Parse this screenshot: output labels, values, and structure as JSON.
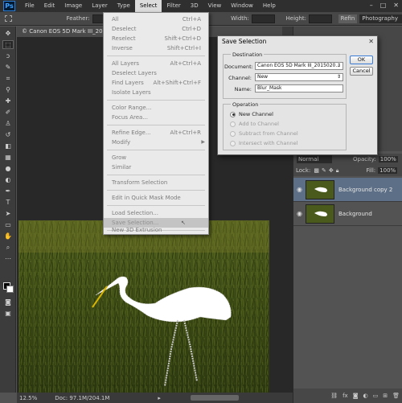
{
  "menubar": {
    "logo": "Ps",
    "items": [
      "File",
      "Edit",
      "Image",
      "Layer",
      "Type",
      "Select",
      "Filter",
      "3D",
      "View",
      "Window",
      "Help"
    ],
    "active": "Select"
  },
  "optbar": {
    "feather_label": "Feather:",
    "width_label": "Width:",
    "height_label": "Height:",
    "refine_label": "Refin",
    "workspace": "Photography"
  },
  "document": {
    "tab_title": "© Canon EOS 5D Mark III_2015020...copy 2, RGB/16...",
    "zoom": "12.5%",
    "doc_size": "Doc: 97.1M/204.1M"
  },
  "select_menu": {
    "items": [
      {
        "label": "All",
        "shortcut": "Ctrl+A"
      },
      {
        "label": "Deselect",
        "shortcut": "Ctrl+D"
      },
      {
        "label": "Reselect",
        "shortcut": "Shift+Ctrl+D"
      },
      {
        "label": "Inverse",
        "shortcut": "Shift+Ctrl+I"
      },
      {
        "label": "All Layers",
        "shortcut": "Alt+Ctrl+A"
      },
      {
        "label": "Deselect Layers",
        "shortcut": ""
      },
      {
        "label": "Find Layers",
        "shortcut": "Alt+Shift+Ctrl+F"
      },
      {
        "label": "Isolate Layers",
        "shortcut": ""
      },
      {
        "label": "Color Range...",
        "shortcut": ""
      },
      {
        "label": "Focus Area...",
        "shortcut": ""
      },
      {
        "label": "Refine Edge...",
        "shortcut": "Alt+Ctrl+R"
      },
      {
        "label": "Modify",
        "shortcut": ""
      },
      {
        "label": "Grow",
        "shortcut": ""
      },
      {
        "label": "Similar",
        "shortcut": ""
      },
      {
        "label": "Transform Selection",
        "shortcut": ""
      },
      {
        "label": "Edit in Quick Mask Mode",
        "shortcut": ""
      },
      {
        "label": "Load Selection...",
        "shortcut": ""
      },
      {
        "label": "Save Selection...",
        "shortcut": ""
      },
      {
        "label": "New 3D Extrusion",
        "shortcut": ""
      }
    ]
  },
  "dialog": {
    "title": "Save Selection",
    "destination_label": "Destination",
    "document_label": "Document:",
    "document_value": "Canon EOS 5D Mark III_2015020...",
    "channel_label": "Channel:",
    "channel_value": "New",
    "name_label": "Name:",
    "name_value": "Blur_Mask",
    "operation_label": "Operation",
    "operations": [
      "New Channel",
      "Add to Channel",
      "Subtract from Channel",
      "Intersect with Channel"
    ],
    "ok": "OK",
    "cancel": "Cancel"
  },
  "layers": {
    "blend_mode": "Normal",
    "opacity_label": "Opacity:",
    "opacity_value": "100%",
    "lock_label": "Lock:",
    "fill_label": "Fill:",
    "fill_value": "100%",
    "items": [
      {
        "name": "Background copy 2",
        "selected": true
      },
      {
        "name": "Background",
        "selected": false
      }
    ]
  },
  "colors": {
    "accent": "#2d7fd5",
    "menu_bg": "#eaeaea",
    "layer_selected": "#5d6f86"
  }
}
